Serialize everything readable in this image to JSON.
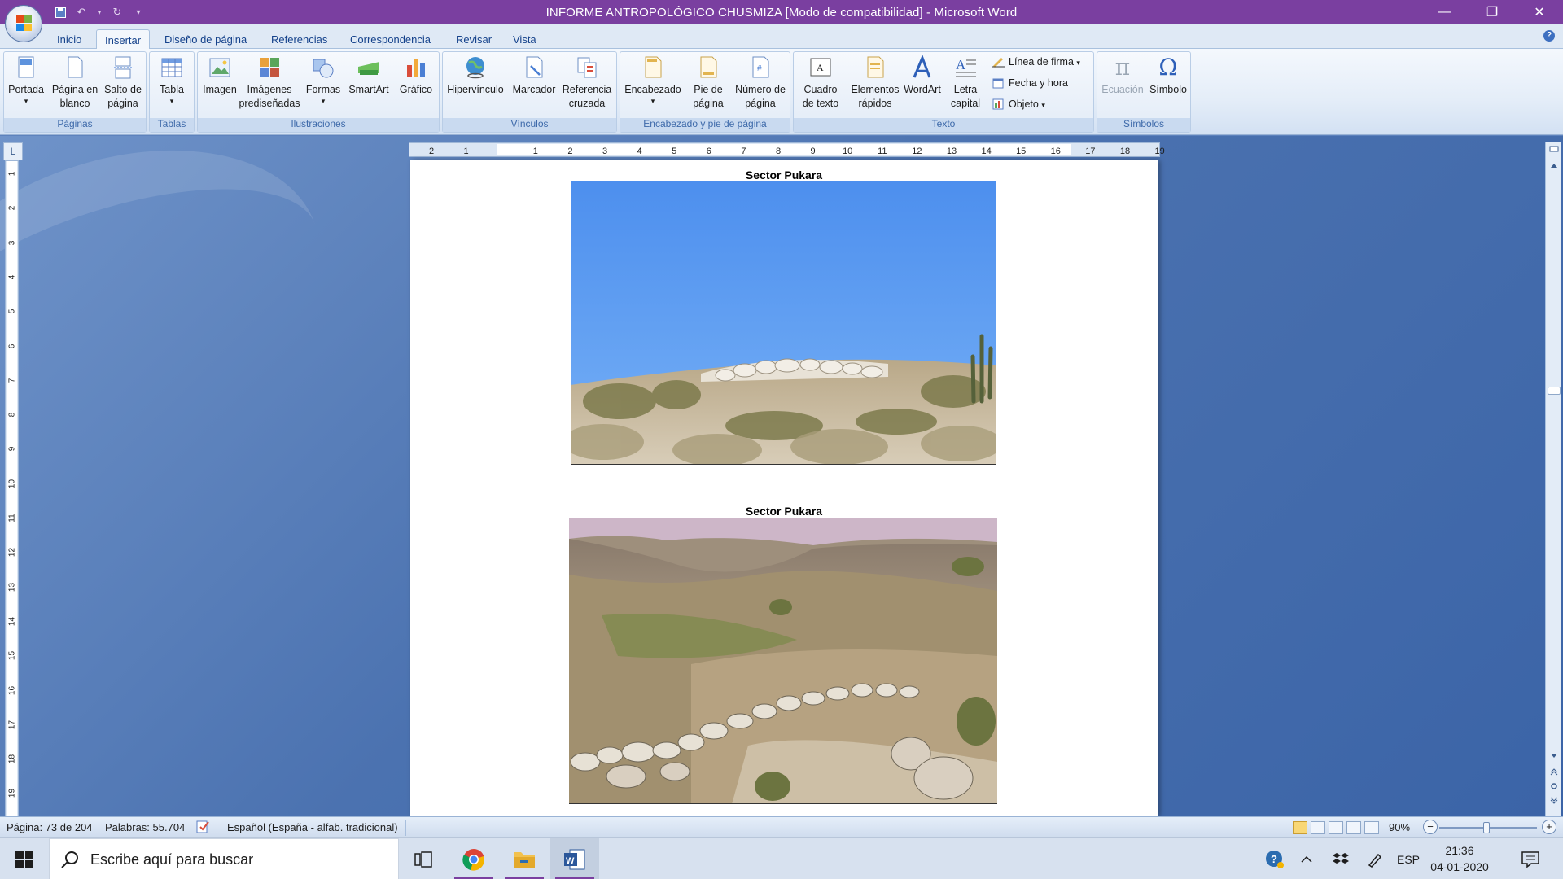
{
  "window": {
    "title": "INFORME ANTROPOLÓGICO CHUSMIZA [Modo de compatibilidad] - Microsoft Word",
    "minimize": "—",
    "restore": "❐",
    "close": "✕"
  },
  "qat": {
    "save": "💾",
    "undo": "↶",
    "redo": "↻",
    "customize": "▾"
  },
  "tabs": [
    "Inicio",
    "Insertar",
    "Diseño de página",
    "Referencias",
    "Correspondencia",
    "Revisar",
    "Vista"
  ],
  "active_tab": "Insertar",
  "help": "?",
  "ribbon": {
    "groups": {
      "paginas": "Páginas",
      "tablas": "Tablas",
      "ilustraciones": "Ilustraciones",
      "vinculos": "Vínculos",
      "encabezado": "Encabezado y pie de página",
      "texto": "Texto",
      "simbolos": "Símbolos"
    },
    "buttons": {
      "portada": "Portada",
      "pagina_blanco": "Página en\nblanco",
      "salto_pagina": "Salto de\npágina",
      "tabla": "Tabla",
      "imagen": "Imagen",
      "imagenes_predisenadas": "Imágenes\nprediseñadas",
      "formas": "Formas",
      "smartart": "SmartArt",
      "grafico": "Gráfico",
      "hipervinculo": "Hipervínculo",
      "marcador": "Marcador",
      "referencia_cruzada": "Referencia\ncruzada",
      "encabezado": "Encabezado",
      "pie_pagina": "Pie de\npágina",
      "numero_pagina": "Número de\npágina",
      "cuadro_texto": "Cuadro\nde texto",
      "elementos_rapidos": "Elementos\nrápidos",
      "wordart": "WordArt",
      "letra_capital": "Letra\ncapital",
      "linea_firma": "Línea de firma",
      "fecha_hora": "Fecha y hora",
      "objeto": "Objeto",
      "ecuacion": "Ecuación",
      "simbolo": "Símbolo"
    },
    "glyphs": {
      "pi": "π",
      "omega": "Ω",
      "dropdown": "▾"
    }
  },
  "ruler": {
    "corner": "L",
    "h_ticks": [
      "2",
      "1",
      "",
      "1",
      "2",
      "3",
      "4",
      "5",
      "6",
      "7",
      "8",
      "9",
      "10",
      "11",
      "12",
      "13",
      "14",
      "15",
      "16",
      "17",
      "18",
      "19"
    ],
    "v_ticks": [
      "1",
      "2",
      "3",
      "4",
      "5",
      "6",
      "7",
      "8",
      "9",
      "10",
      "11",
      "12",
      "13",
      "14",
      "15",
      "16",
      "17",
      "18",
      "19"
    ]
  },
  "document": {
    "caption_1": "Sector Pukara",
    "caption_2": "Sector Pukara"
  },
  "statusbar": {
    "page": "Página: 73 de 204",
    "words": "Palabras: 55.704",
    "language": "Español (España - alfab. tradicional)",
    "zoom": "90%",
    "zoom_out": "−",
    "zoom_in": "+"
  },
  "taskbar": {
    "search_placeholder": "Escribe aquí para buscar",
    "lang": "ESP",
    "time": "21:36",
    "date": "04-01-2020"
  },
  "colors": {
    "title_bar": "#7a3fa0",
    "ribbon_text": "#15428b",
    "sky": "#5a9af0"
  }
}
